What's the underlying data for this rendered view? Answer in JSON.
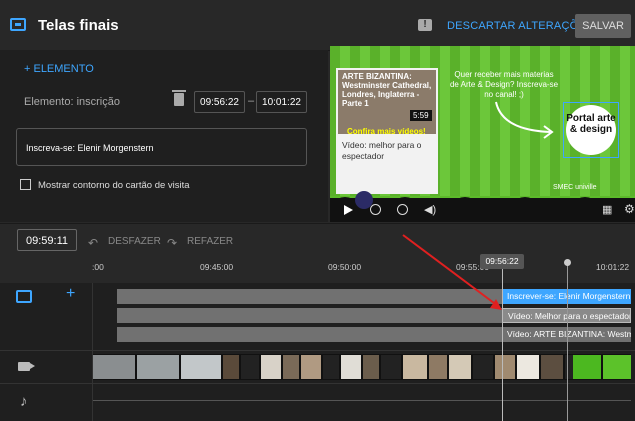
{
  "header": {
    "title": "Telas finais",
    "discard_label": "DESCARTAR ALTERAÇÕES",
    "save_label": "SALVAR"
  },
  "editor": {
    "add_element_label": "+ ELEMENTO",
    "element_label": "Elemento: inscrição",
    "start_time": "09:56:22",
    "time_separator": "–",
    "end_time": "10:01:22",
    "card_text": "Inscreva-se: Elenir Morgenstern",
    "show_outline_label": "Mostrar contorno do cartão de visita"
  },
  "preview": {
    "video_card_title": "ARTE BIZANTINA: Westminster Cathedral, Londres, Inglaterra - Parte 1",
    "video_card_duration": "5:59",
    "video_card_badge": "Confira mais vídeos!",
    "video_card_caption": "Vídeo: melhor para o espectador",
    "promo_text": "Quer receber mais materias de Arte & Design? Inscreva-se no canal! ;)",
    "logo_text": "Portal arte & design",
    "brand_text": "SMEC  univille"
  },
  "timeline": {
    "current_time": "09:59:11",
    "undo_label": "DESFAZER",
    "redo_label": "REFAZER",
    "ticks": [
      ":00",
      "09:45:00",
      "09:50:00",
      "09:55:00",
      "10:01:22"
    ],
    "playhead_label": "09:56:22",
    "tracks": [
      {
        "label": "Inscrever-se: Elenir Morgenstern",
        "highlight": true
      },
      {
        "label": "Vídeo: Melhor para o espectador",
        "highlight": false
      },
      {
        "label": "Vídeo: ARTE BIZANTINA: Westminster",
        "highlight": false
      }
    ]
  },
  "colors": {
    "accent": "#3ea6ff",
    "preview_green": "#5cba2a",
    "annotation_arrow": "#e02020"
  }
}
